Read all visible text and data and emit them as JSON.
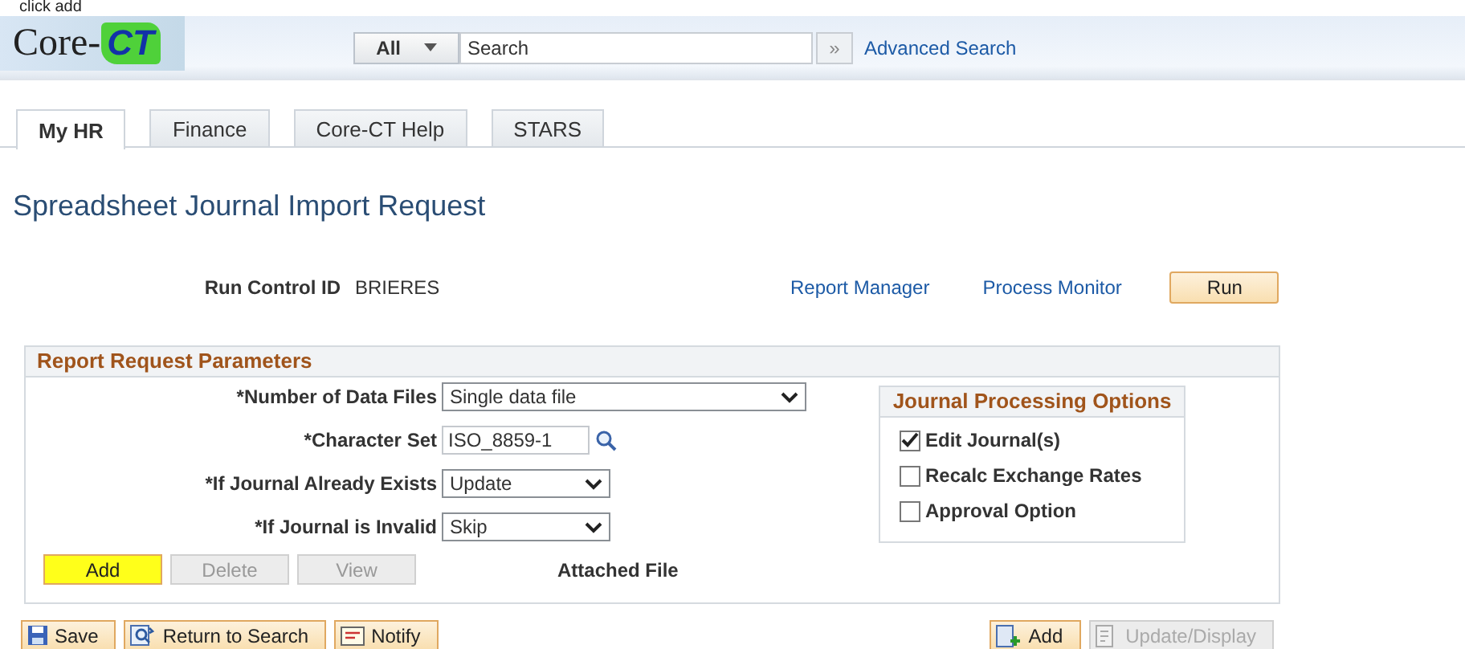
{
  "caption": "click add",
  "header": {
    "logo": {
      "left": "Core-",
      "right": "CT"
    },
    "search": {
      "scope": "All",
      "placeholder": "Search",
      "go": "»"
    },
    "advanced_search": "Advanced Search"
  },
  "tabs": [
    {
      "label": "My HR",
      "selected": true
    },
    {
      "label": "Finance",
      "selected": false
    },
    {
      "label": "Core-CT Help",
      "selected": false
    },
    {
      "label": "STARS",
      "selected": false
    }
  ],
  "page_title": "Spreadsheet Journal Import Request",
  "run_control": {
    "label": "Run Control ID",
    "value": "BRIERES",
    "links": [
      "Report Manager",
      "Process Monitor"
    ],
    "run_button": "Run"
  },
  "panel": {
    "title": "Report Request Parameters",
    "fields": [
      {
        "kind": "select",
        "label": "*Number of Data Files",
        "value": "Single data file",
        "wide": true
      },
      {
        "kind": "lookup",
        "label": "*Character Set",
        "value": "ISO_8859-1"
      },
      {
        "kind": "select",
        "label": "*If Journal Already Exists",
        "value": "Update",
        "wide": false
      },
      {
        "kind": "select",
        "label": "*If Journal is Invalid",
        "value": "Skip",
        "wide": false
      }
    ],
    "buttons": [
      {
        "label": "Add",
        "disabled": false,
        "highlighted": true
      },
      {
        "label": "Delete",
        "disabled": true,
        "highlighted": false
      },
      {
        "label": "View",
        "disabled": true,
        "highlighted": false
      }
    ],
    "attached_file": "Attached File",
    "options": {
      "title": "Journal Processing Options",
      "items": [
        {
          "label": "Edit Journal(s)",
          "checked": true
        },
        {
          "label": "Recalc Exchange Rates",
          "checked": false
        },
        {
          "label": "Approval Option",
          "checked": false
        }
      ]
    }
  },
  "footer": {
    "left": [
      {
        "label": "Save",
        "kind": "save",
        "disabled": false
      },
      {
        "label": "Return to Search",
        "kind": "search",
        "disabled": false
      },
      {
        "label": "Notify",
        "kind": "notify",
        "disabled": false
      }
    ],
    "right": [
      {
        "label": "Add",
        "kind": "add",
        "disabled": false
      },
      {
        "label": "Update/Display",
        "kind": "update",
        "disabled": true
      }
    ]
  }
}
